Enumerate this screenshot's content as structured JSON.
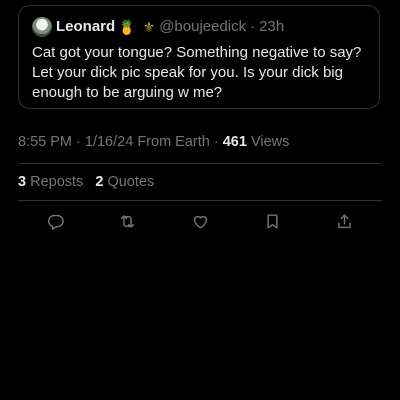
{
  "quoted_tweet": {
    "display_name": "Leonard",
    "emojis": [
      "🍍",
      "⚜"
    ],
    "handle": "@boujeedick",
    "separator": "·",
    "time_ago": "23h",
    "text": "Cat got your tongue? Something negative to say? Let your dick pic speak for you. Is your dick big enough to be arguing w me?"
  },
  "meta": {
    "time": "8:55 PM",
    "separator": "·",
    "date": "1/16/24",
    "source": "From Earth",
    "views_count": "461",
    "views_label": "Views"
  },
  "stats": {
    "reposts_count": "3",
    "reposts_label": "Reposts",
    "quotes_count": "2",
    "quotes_label": "Quotes"
  },
  "actions": [
    "reply-icon",
    "repost-icon",
    "like-icon",
    "bookmark-icon",
    "share-icon"
  ],
  "colors": {
    "background": "#000000",
    "text": "#e7e9ea",
    "muted": "#71767b",
    "border": "#2f3336"
  }
}
